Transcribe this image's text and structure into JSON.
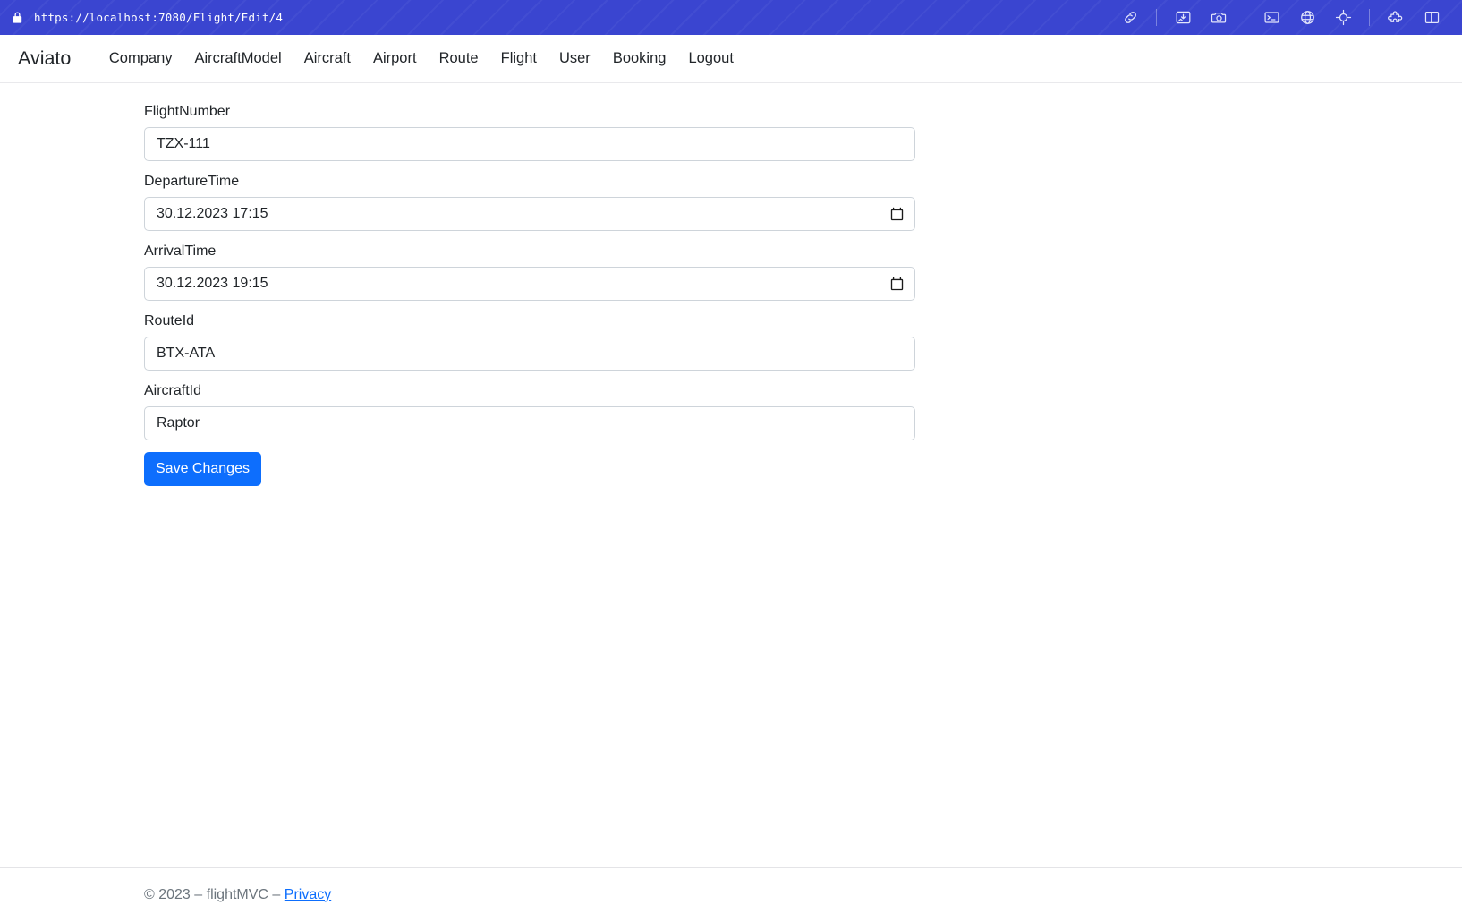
{
  "browser": {
    "url": "https://localhost:7080/Flight/Edit/4",
    "lock_icon": "lock-icon",
    "toolbar_icons": [
      {
        "name": "link-icon"
      },
      {
        "name": "image-download-icon"
      },
      {
        "name": "camera-icon"
      },
      {
        "name": "terminal-icon"
      },
      {
        "name": "globe-icon"
      },
      {
        "name": "crosshair-icon"
      },
      {
        "name": "puzzle-piece-icon"
      },
      {
        "name": "split-panel-icon"
      }
    ],
    "bar_color": "#3a45d0"
  },
  "navbar": {
    "brand": "Aviato",
    "links": [
      {
        "label": "Company"
      },
      {
        "label": "AircraftModel"
      },
      {
        "label": "Aircraft"
      },
      {
        "label": "Airport"
      },
      {
        "label": "Route"
      },
      {
        "label": "Flight"
      },
      {
        "label": "User"
      },
      {
        "label": "Booking"
      },
      {
        "label": "Logout"
      }
    ]
  },
  "form": {
    "fields": [
      {
        "label": "FlightNumber",
        "value": "TZX-111",
        "type": "text",
        "placeholder": ""
      },
      {
        "label": "DepartureTime",
        "value": "30.12.2023 17:15",
        "type": "datetime",
        "placeholder": ""
      },
      {
        "label": "ArrivalTime",
        "value": "30.12.2023 19:15",
        "type": "datetime",
        "placeholder": ""
      },
      {
        "label": "RouteId",
        "value": "BTX-ATA",
        "type": "text",
        "placeholder": ""
      },
      {
        "label": "AircraftId",
        "value": "Raptor",
        "type": "text",
        "placeholder": ""
      }
    ],
    "submit_label": "Save Changes",
    "submit_color": "#0d6efd"
  },
  "footer": {
    "copyright": "© 2023 – flightMVC – ",
    "privacy_label": "Privacy"
  }
}
